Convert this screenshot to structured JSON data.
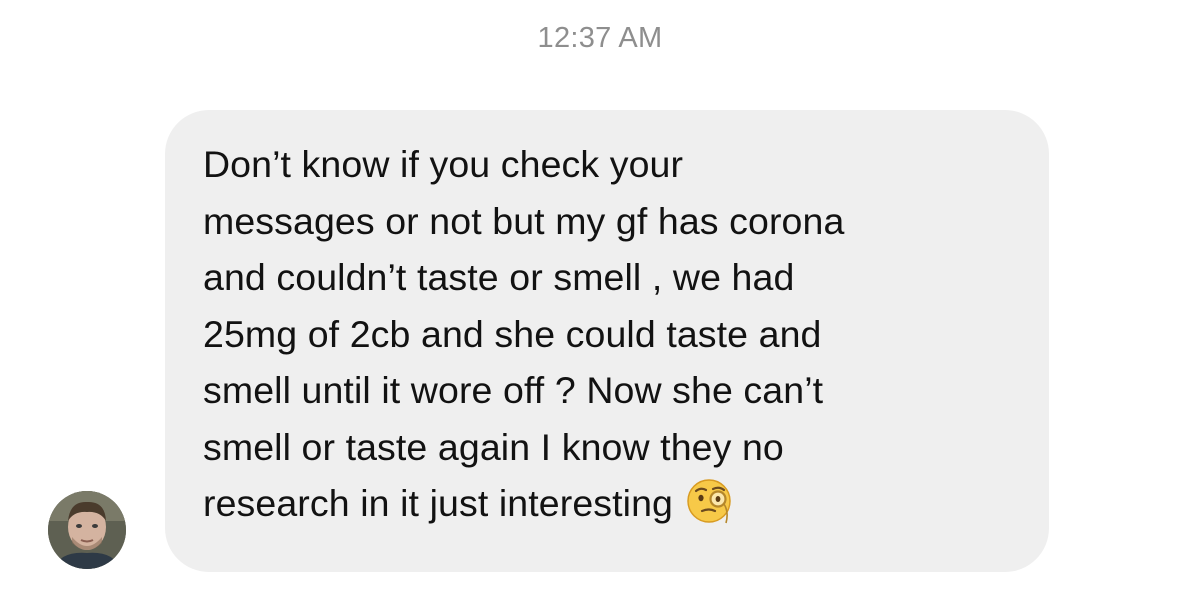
{
  "timestamp": "12:37 AM",
  "message": {
    "text": "Don’t know if you check your\nmessages or not but my gf has corona\nand couldn’t taste or smell , we had\n25mg of 2cb and she could taste and\nsmell until it wore off ? Now she can’t\nsmell or taste again I know they no\nresearch in it just interesting",
    "emoji": "face-with-monocle"
  },
  "colors": {
    "bubble": "#efefef",
    "text": "#121212",
    "timestamp": "#8e8e8e"
  }
}
